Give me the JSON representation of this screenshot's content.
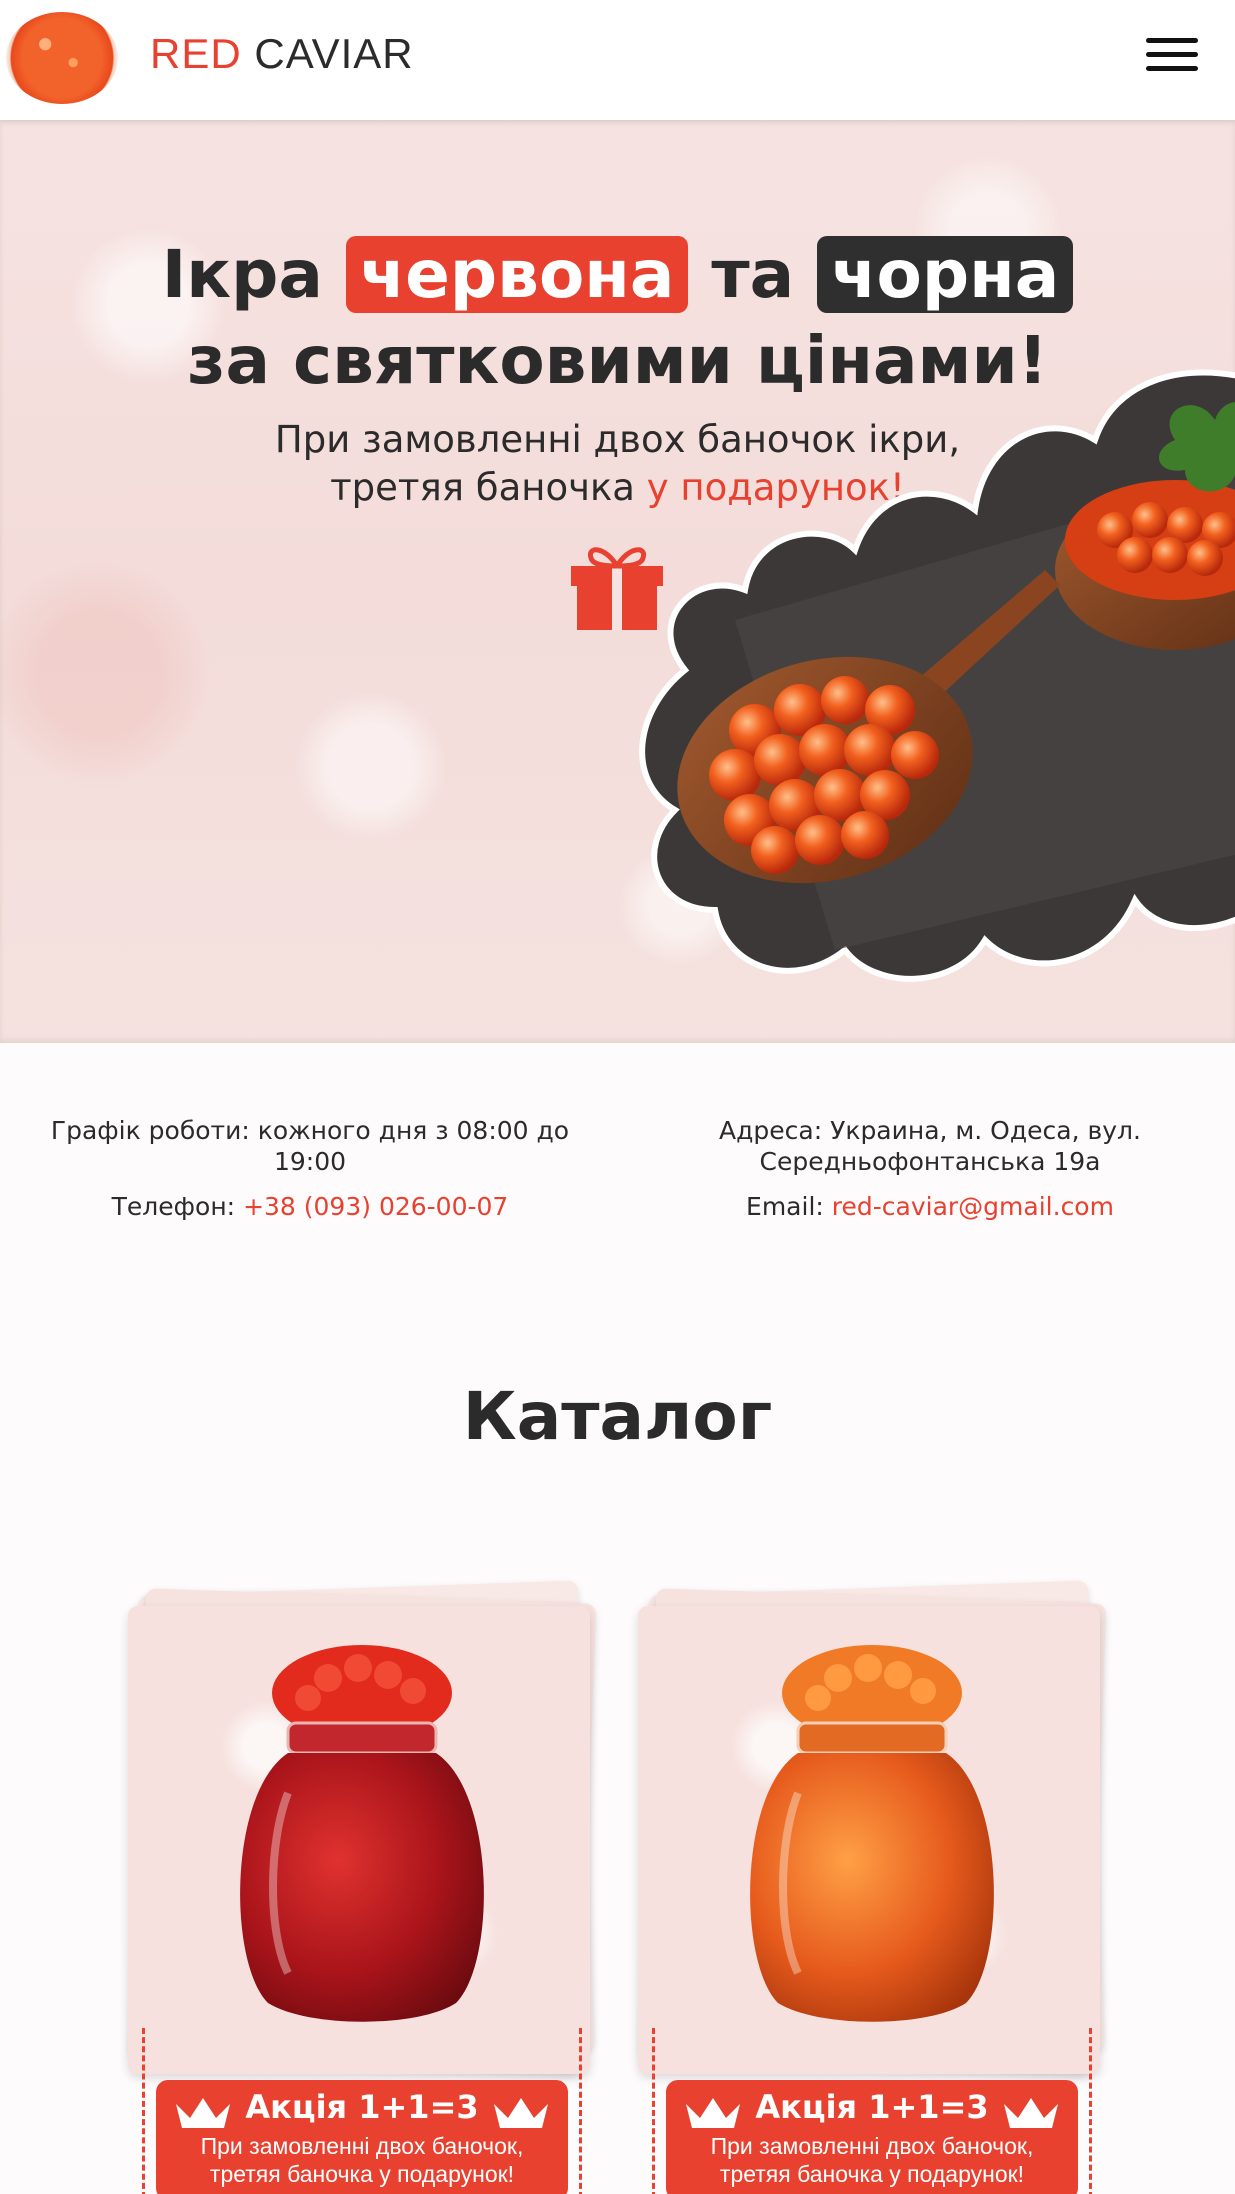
{
  "header": {
    "brand_red": "RED",
    "brand_dark": "CAVIAR"
  },
  "hero": {
    "title_part1": "Ікра",
    "title_red": "червона",
    "title_part2": "та",
    "title_dark": "чорна",
    "title_line2": "за святковими цінами!",
    "subtitle_line1": "При замовленні двох баночок ікри,",
    "subtitle_line2_plain": "третяя баночка",
    "subtitle_line2_accent": "у подарунок!"
  },
  "info": {
    "schedule": "Графік роботи: кожного дня з 08:00 до 19:00",
    "address_line1": "Адреса: Украина, м. Одеса, вул.",
    "address_line2": "Середньофонтанська 19а",
    "phone_label": "Телефон:",
    "phone_value": "+38 (093) 026-00-07",
    "email_label": "Email:",
    "email_value": "red-caviar@gmail.com"
  },
  "catalog": {
    "title": "Каталог",
    "products": [
      {
        "promo_title": "Акція 1+1=3",
        "promo_line1": "При замовленні двох баночок,",
        "promo_line2": "третяя баночка у подарунок!",
        "jar_color": "#b5161b"
      },
      {
        "promo_title": "Акція 1+1=3",
        "promo_line1": "При замовленні двох баночок,",
        "promo_line2": "третяя баночка у подарунок!",
        "jar_color": "#e65a1c"
      }
    ]
  },
  "colors": {
    "accent": "#e8412f",
    "dark": "#2f2f2f"
  },
  "icons": [
    "menu-icon",
    "gift-icon",
    "crown-icon"
  ]
}
